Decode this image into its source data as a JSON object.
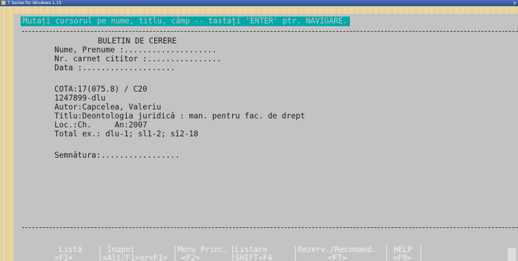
{
  "window": {
    "title": "T Series for Windows 1.15",
    "close": "x"
  },
  "prompt": "Mutați cursorul pe nume, titlu, câmp -- tastați 'ENTER' ptr. NAVIGARE.",
  "form": {
    "heading": "BULETIN DE CERERE",
    "name": "Nume, Prenume :....................",
    "card": "Nr. carnet cititor :................",
    "date": "Data :....................",
    "cota": "COTA:17(075.8) / C20",
    "code": "1247899-dlu",
    "author": "Autor:Capcelea, Valeriu",
    "title": "Titlu:Deontologia juridică : man. pentru fac. de drept",
    "loc": "Loc.:Ch.     An:2007",
    "total": "Total ex.: dlu-1; sl1-2; sî2-18",
    "signature": "Semnătura:................."
  },
  "footer": {
    "labels": [
      " Listă ",
      " Înapoi ",
      "Menu Princ.",
      "Listare ",
      "Rezerv./Recomand.",
      " HELP "
    ],
    "keys": [
      "<F1>",
      "<Alt/F1>or<F1>",
      "<F2>",
      "SHIFT+F4",
      "<F7>",
      "<F9>"
    ],
    "separator": "|"
  }
}
